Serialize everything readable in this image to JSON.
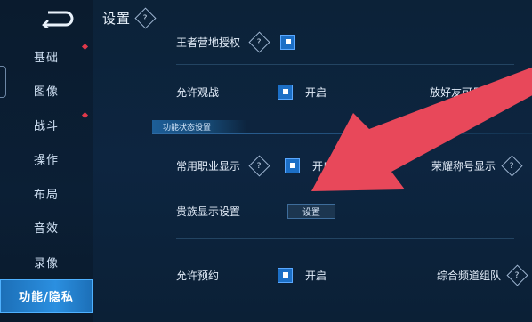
{
  "sidebar": {
    "items": [
      {
        "label": "基础",
        "dot": true
      },
      {
        "label": "图像",
        "dot": false
      },
      {
        "label": "战斗",
        "dot": true
      },
      {
        "label": "操作",
        "dot": false
      },
      {
        "label": "布局",
        "dot": false
      },
      {
        "label": "音效",
        "dot": false
      },
      {
        "label": "录像",
        "dot": false
      },
      {
        "label": "功能/隐私",
        "dot": false,
        "active": true
      }
    ]
  },
  "header": {
    "title": "设置"
  },
  "rows": {
    "king_camp": {
      "label": "王者营地授权"
    },
    "allow_spectate": {
      "label": "允许观战",
      "value": "开启"
    },
    "section_title": "功能状态设置",
    "common_job": {
      "label": "常用职业显示",
      "value": "开启"
    },
    "noble": {
      "label": "贵族显示设置",
      "button": "设置"
    },
    "allow_reserve": {
      "label": "允许预约",
      "value": "开启"
    }
  },
  "right": {
    "friend_visible": "放好友可见",
    "honor_title": "荣耀称号显示",
    "channel_team": "综合频道组队"
  },
  "colors": {
    "accent": "#2b8fe0",
    "arrow": "#e8485a",
    "dot": "#e0384a"
  }
}
